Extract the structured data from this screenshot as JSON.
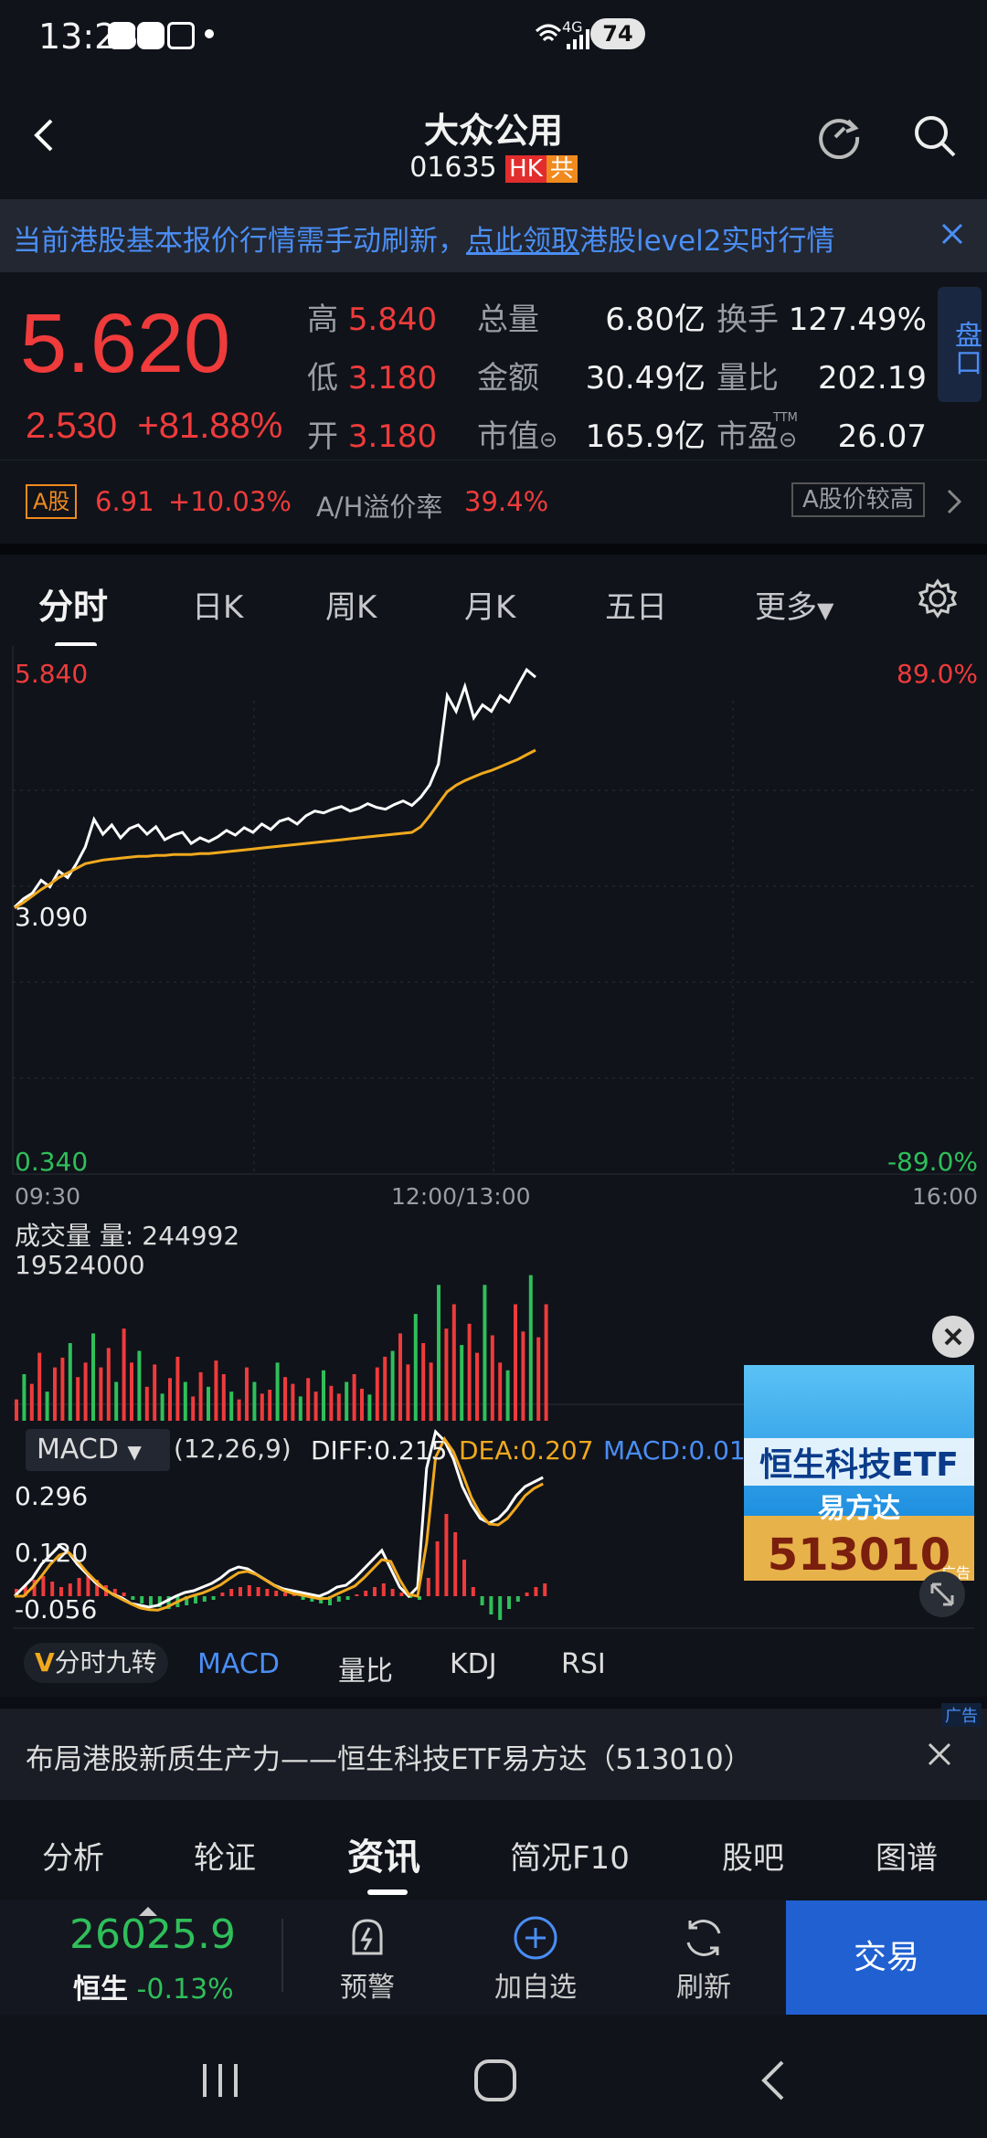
{
  "status": {
    "time": "13:28",
    "battery": "74",
    "net": "4G"
  },
  "header": {
    "title": "大众公用",
    "code": "01635",
    "badge_hk": "HK",
    "badge_gong": "共"
  },
  "banner": {
    "text_a": "当前港股基本报价行情需手动刷新，",
    "text_link": "点此领取",
    "text_b": "港股level2实时行情"
  },
  "quote": {
    "price": "5.620",
    "change": "2.530",
    "change_pct": "+81.88%",
    "high_label": "高",
    "high": "5.840",
    "low_label": "低",
    "low": "3.180",
    "open_label": "开",
    "open": "3.180",
    "vol_label": "总量",
    "vol": "6.80亿",
    "amt_label": "金额",
    "amt": "30.49亿",
    "mcap_label": "市值",
    "mcap": "165.9亿",
    "turn_label": "换手",
    "turn": "127.49%",
    "vr_label": "量比",
    "vr": "202.19",
    "pe_label": "市盈",
    "pe": "26.07",
    "ttm": "TTM",
    "side_tab": "盘口"
  },
  "arow": {
    "tag": "A股",
    "price": "6.91",
    "pct": "+10.03%",
    "prem_label": "A/H溢价率",
    "prem": "39.4%",
    "btn": "A股价较高"
  },
  "tabs": [
    "分时",
    "日K",
    "周K",
    "月K",
    "五日",
    "更多"
  ],
  "chart_data": {
    "type": "line",
    "y_top": "5.840",
    "y_mid": "3.090",
    "y_bot": "0.340",
    "pct_top": "89.0%",
    "pct_bot": "-89.0%",
    "x_start": "09:30",
    "x_mid": "12:00/13:00",
    "x_end": "16:00",
    "ylim": [
      0.34,
      5.84
    ],
    "series": [
      {
        "values": [
          3.23,
          3.32,
          3.38,
          3.52,
          3.45,
          3.62,
          3.55,
          3.7,
          3.88,
          4.18,
          4.02,
          4.12,
          3.98,
          4.08,
          4.12,
          4.02,
          4.1,
          3.96,
          4.01,
          4.04,
          3.92,
          3.98,
          3.94,
          3.99,
          4.06,
          4.01,
          4.09,
          4.04,
          4.13,
          4.07,
          4.16,
          4.19,
          4.13,
          4.22,
          4.27,
          4.25,
          4.29,
          4.32,
          4.27,
          4.3,
          4.35,
          4.31,
          4.29,
          4.34,
          4.38,
          4.33,
          4.42,
          4.55,
          4.78,
          5.52,
          5.35,
          5.62,
          5.28,
          5.42,
          5.35,
          5.52,
          5.45,
          5.63,
          5.8,
          5.72
        ]
      },
      {
        "values": [
          3.22,
          3.28,
          3.35,
          3.42,
          3.48,
          3.55,
          3.6,
          3.65,
          3.7,
          3.72,
          3.74,
          3.75,
          3.76,
          3.77,
          3.78,
          3.78,
          3.79,
          3.79,
          3.8,
          3.8,
          3.8,
          3.81,
          3.81,
          3.82,
          3.83,
          3.84,
          3.85,
          3.86,
          3.87,
          3.88,
          3.89,
          3.9,
          3.91,
          3.92,
          3.93,
          3.94,
          3.95,
          3.96,
          3.97,
          3.98,
          3.99,
          4.0,
          4.01,
          4.02,
          4.03,
          4.04,
          4.1,
          4.22,
          4.35,
          4.48,
          4.55,
          4.6,
          4.64,
          4.68,
          4.71,
          4.75,
          4.79,
          4.83,
          4.88,
          4.93
        ]
      }
    ]
  },
  "volume": {
    "title": "成交量",
    "vol_label": "量:",
    "vol": "244992",
    "max": "19524000",
    "bars": [
      22,
      48,
      38,
      70,
      30,
      55,
      65,
      80,
      45,
      60,
      90,
      55,
      75,
      40,
      95,
      60,
      72,
      35,
      58,
      28,
      44,
      66,
      40,
      25,
      50,
      35,
      62,
      48,
      30,
      22,
      55,
      40,
      28,
      32,
      60,
      45,
      38,
      25,
      44,
      30,
      52,
      36,
      28,
      40,
      48,
      33,
      27,
      55,
      66,
      72,
      90,
      58,
      110,
      80,
      60,
      140,
      95,
      120,
      78,
      100,
      70,
      140,
      88,
      60,
      52,
      120,
      92,
      150,
      86,
      120
    ]
  },
  "macd": {
    "dropdown": "MACD",
    "params": "(12,26,9)",
    "diff": "DIFF:0.215",
    "dea": "DEA:0.207",
    "macd": "MACD:0.01",
    "y_top": "0.296",
    "y_mid": "0.120",
    "y_bot": "-0.056"
  },
  "indicators": {
    "vtag": "V",
    "vlabel": "分时九转",
    "items": [
      "MACD",
      "量比",
      "KDJ",
      "RSI"
    ]
  },
  "ad_float": {
    "title": "恒生科技ETF",
    "sub": "易方达",
    "code": "513010",
    "ad": "广告"
  },
  "adbar": {
    "text": "布局港股新质生产力——恒生科技ETF易方达（513010）",
    "ad": "广告"
  },
  "btabs": [
    "分析",
    "轮证",
    "资讯",
    "简况F10",
    "股吧",
    "图谱"
  ],
  "bottombar": {
    "index_val": "26025.9",
    "index_name": "恒生",
    "index_pct": "-0.13%",
    "alert": "预警",
    "add": "加自选",
    "refresh": "刷新",
    "trade": "交易"
  },
  "colors": {
    "up": "#ef3b3b",
    "down": "#2fbf5a",
    "link": "#4a8ef5",
    "accent": "#2060d0",
    "avg_line": "#f0a91e"
  }
}
